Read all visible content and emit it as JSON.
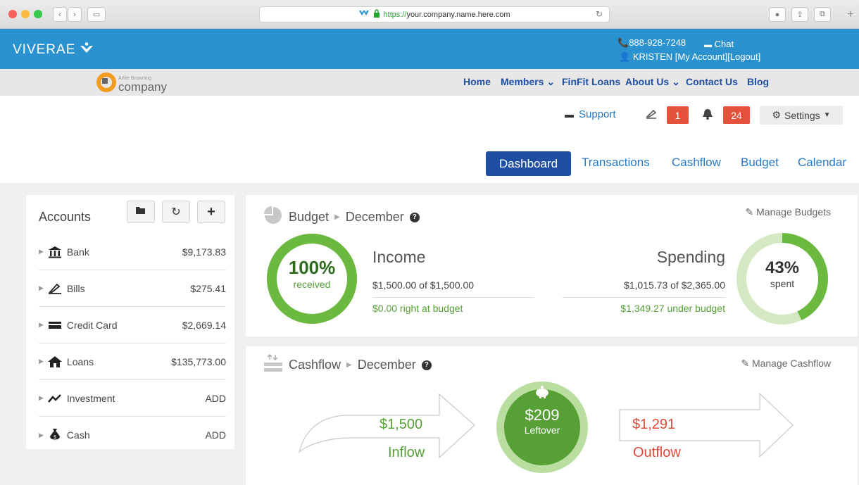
{
  "browser": {
    "url_protocol": "https://",
    "url_host": "your.company.name.here.com"
  },
  "header": {
    "brand": "VIVERAE",
    "phone": "888-928-7248",
    "chat": "Chat",
    "user": "KRISTEN",
    "my_account": "[My Account]",
    "logout": "[Logout]"
  },
  "company": {
    "small_name": "Arlite Browning",
    "name": "company"
  },
  "nav": {
    "items": [
      "Home",
      "Members ⌄",
      "FinFit Loans",
      "About Us ⌄",
      "Contact Us",
      "Blog"
    ]
  },
  "toolbar": {
    "support": "Support",
    "messages_count": "1",
    "notifications_count": "24",
    "settings": "Settings"
  },
  "tabs": [
    "Dashboard",
    "Transactions",
    "Cashflow",
    "Budget",
    "Calendar"
  ],
  "accounts": {
    "title": "Accounts",
    "items": [
      {
        "label": "Bank",
        "value": "$9,173.83",
        "icon": "bank-icon"
      },
      {
        "label": "Bills",
        "value": "$275.41",
        "icon": "bills-icon"
      },
      {
        "label": "Credit Card",
        "value": "$2,669.14",
        "icon": "credit-card-icon"
      },
      {
        "label": "Loans",
        "value": "$135,773.00",
        "icon": "house-icon"
      },
      {
        "label": "Investment",
        "value": "ADD",
        "icon": "trend-icon"
      },
      {
        "label": "Cash",
        "value": "ADD",
        "icon": "money-bag-icon"
      }
    ]
  },
  "budget": {
    "title": "Budget",
    "month": "December",
    "manage": "Manage Budgets",
    "income_percent": "100%",
    "income_percent_value": 1.0,
    "income_sub": "received",
    "income_label": "Income",
    "income_amount": "$1,500.00 of $1,500.00",
    "income_status": "$0.00 right at budget",
    "spending_label": "Spending",
    "spending_amount": "$1,015.73 of $2,365.00",
    "spending_status": "$1,349.27 under budget",
    "spending_percent": "43%",
    "spending_percent_value": 0.43,
    "spending_sub": "spent",
    "colors": {
      "green": "#6cb93f",
      "light_green": "#d3e8c3"
    }
  },
  "cashflow": {
    "title": "Cashflow",
    "month": "December",
    "manage": "Manage Cashflow",
    "inflow_amount": "$1,500",
    "inflow_label": "Inflow",
    "leftover_amount": "$209",
    "leftover_label": "Leftover",
    "outflow_amount": "$1,291",
    "outflow_label": "Outflow",
    "colors": {
      "green": "#56a036",
      "red": "#e24a3a"
    }
  }
}
